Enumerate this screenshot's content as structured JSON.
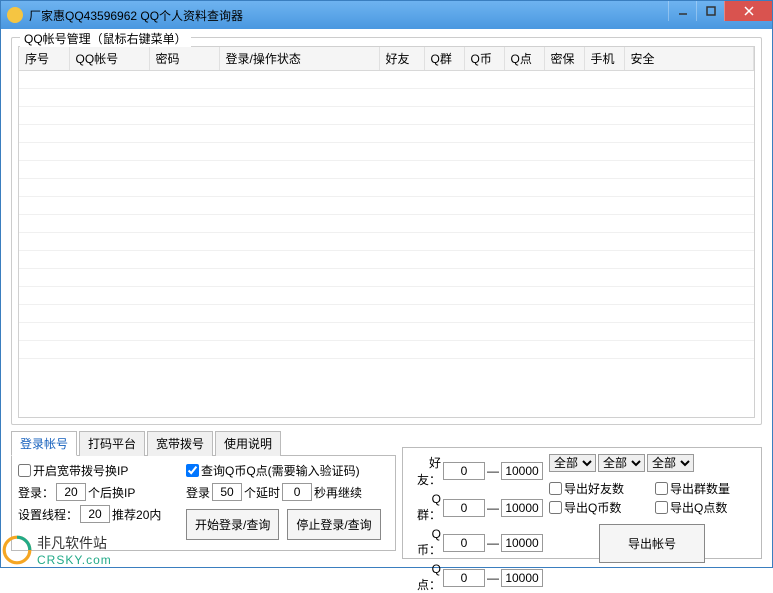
{
  "window": {
    "title": "厂家惠QQ43596962 QQ个人资料查询器"
  },
  "group": {
    "title": "QQ帐号管理（鼠标右键菜单）"
  },
  "columns": [
    "序号",
    "QQ帐号",
    "密码",
    "登录/操作状态",
    "好友",
    "Q群",
    "Q币",
    "Q点",
    "密保",
    "手机",
    "安全"
  ],
  "tabs": [
    "登录帐号",
    "打码平台",
    "宽带拨号",
    "使用说明"
  ],
  "login": {
    "enable_dial_label": "开启宽带拨号换IP",
    "login_prefix": "登录：",
    "login_interval": "20",
    "login_suffix": "个后换IP",
    "thread_prefix": "设置线程：",
    "thread_value": "20",
    "thread_suffix": "推荐20内",
    "query_qb_label": "查询Q币Q点(需要输入验证码)",
    "login_count_prefix": "登录",
    "login_count": "50",
    "delay_prefix": "个延时",
    "delay_value": "0",
    "delay_suffix": "秒再继续",
    "start_btn": "开始登录/查询",
    "stop_btn": "停止登录/查询"
  },
  "filter": {
    "friends_label": "好友：",
    "friends_min": "0",
    "friends_max": "10000",
    "groups_label": "Q群：",
    "groups_min": "0",
    "groups_max": "10000",
    "qb_label": "Q币：",
    "qb_min": "0",
    "qb_max": "10000",
    "qd_label": "Q点：",
    "qd_min": "0",
    "qd_max": "10000",
    "dash": "—",
    "sel_all": "全部",
    "export_friends": "导出好友数",
    "export_groups": "导出群数量",
    "export_qb": "导出Q币数",
    "export_qd": "导出Q点数",
    "export_btn": "导出帐号"
  },
  "watermark": {
    "text": "非凡软件站",
    "url": "CRSKY.com"
  }
}
